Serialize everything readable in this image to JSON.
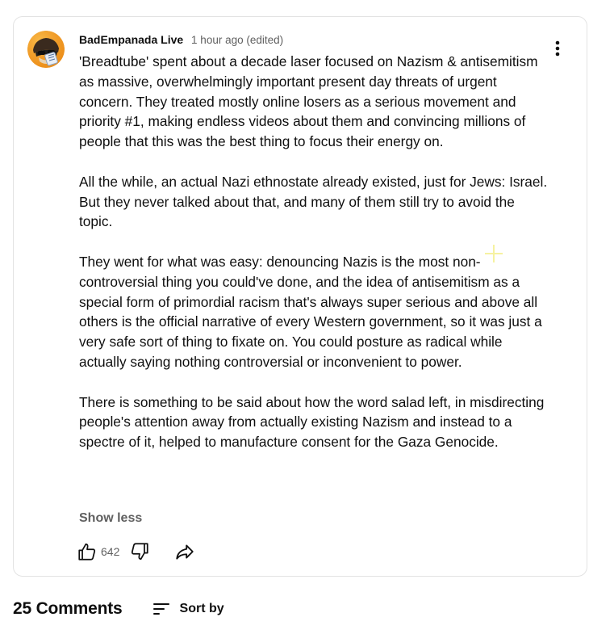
{
  "comment": {
    "author": "BadEmpanada Live",
    "timestamp": "1 hour ago (edited)",
    "paragraphs": [
      "'Breadtube' spent about a decade laser focused on Nazism & antisemitism as massive, overwhelmingly important present day threats of urgent concern. They treated mostly online losers as a serious movement and priority #1, making endless videos about them and convincing millions of people that this was the best thing to focus their energy on.",
      "All the while, an actual Nazi ethnostate already existed, just for Jews: Israel. But they never talked about that, and many of them still try to avoid the topic.",
      "They went for what was easy: denouncing Nazis is the most non-controversial thing you could've done, and the idea of antisemitism as a special form of primordial racism that's always super serious and above all others is the official narrative of every Western government, so it was just a very safe sort of thing to fixate on. You could posture as radical while actually saying nothing controversial or inconvenient to power.",
      "There is something to be said about how the word salad left, in misdirecting people's attention away from actually existing Nazism and instead to a spectre of it, helped to manufacture consent for the Gaza Genocide."
    ],
    "show_less_label": "Show less",
    "like_count": "642",
    "icons": {
      "avatar": "avatar-image",
      "menu": "more-vert-icon",
      "like": "thumbs-up-icon",
      "dislike": "thumbs-down-icon",
      "share": "share-arrow-icon"
    }
  },
  "comments_section": {
    "count_label": "25 Comments",
    "sort_label": "Sort by",
    "sort_icon": "sort-icon"
  },
  "colors": {
    "text": "#0f0f0f",
    "secondary_text": "#606060",
    "border": "#e3e3e3",
    "avatar_bg": "#f29a1c"
  }
}
